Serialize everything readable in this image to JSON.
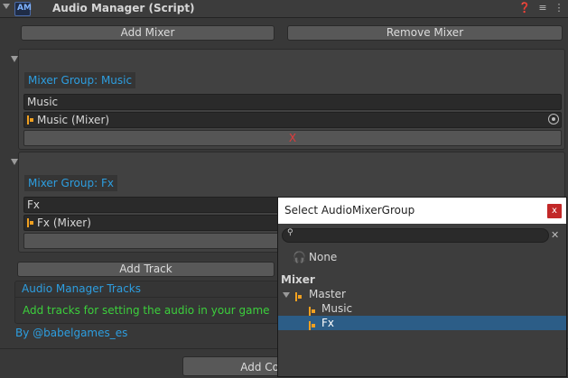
{
  "component": {
    "title": "Audio Manager (Script)",
    "script_icon_text": "AM"
  },
  "header_icons": [
    "help-icon",
    "settings-icon",
    "overflow-menu-icon"
  ],
  "buttons": {
    "add_mixer": "Add Mixer",
    "remove_mixer": "Remove Mixer",
    "add_track": "Add Track",
    "add_bottom": "Add Co"
  },
  "groups": [
    {
      "label": "Mixer Group: Music",
      "name_value": "Music",
      "mixer_value": "Music (Mixer)",
      "remove_label": "X"
    },
    {
      "label": "Mixer Group: Fx",
      "name_value": "Fx",
      "mixer_value": "Fx (Mixer)"
    }
  ],
  "tracks": {
    "header": "Audio Manager Tracks",
    "hint": "Add tracks for setting the audio in your game"
  },
  "credit": "By @babelgames_es",
  "popup": {
    "title": "Select AudioMixerGroup",
    "close_label": "x",
    "search_placeholder": "",
    "none_label": "None",
    "section_label": "Mixer",
    "tree": [
      "Master",
      "Music",
      "Fx"
    ],
    "selected": "Fx"
  },
  "colors": {
    "accent_blue": "#2d9ee0",
    "hint_green": "#3ccf3c",
    "remove_red": "#e23a3a",
    "selection": "#2c5d87",
    "mixer_icon": "#f0a020"
  }
}
